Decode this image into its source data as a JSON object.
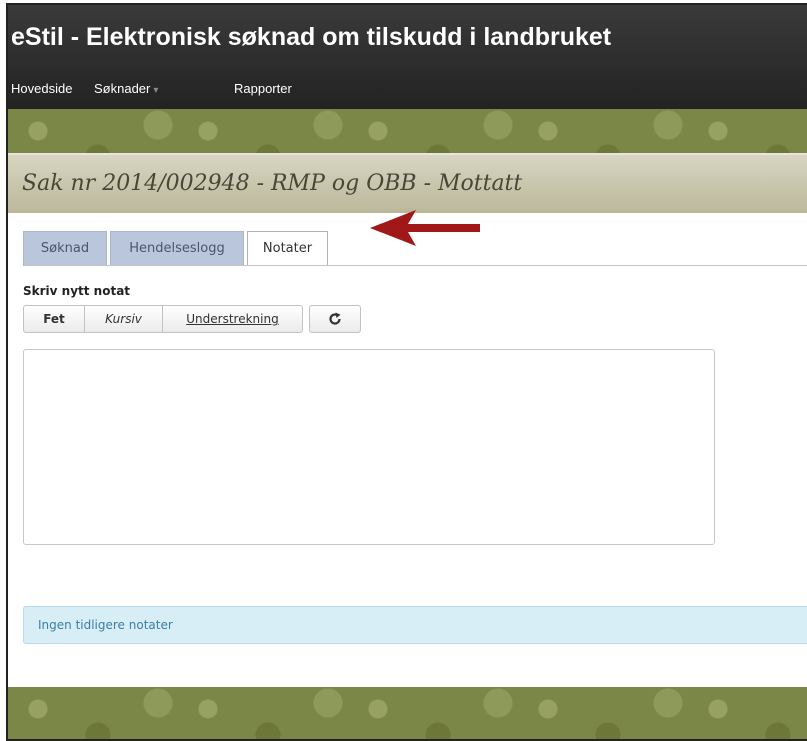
{
  "app": {
    "title": "eStil - Elektronisk søknad om tilskudd i landbruket"
  },
  "nav": {
    "items": [
      {
        "label": "Hovedside"
      },
      {
        "label": "Søknader"
      },
      {
        "label": "Rapporter"
      }
    ]
  },
  "case": {
    "title": "Sak nr 2014/002948 - RMP og OBB - Mottatt"
  },
  "tabs": [
    {
      "label": "Søknad",
      "active": false
    },
    {
      "label": "Hendelseslogg",
      "active": false
    },
    {
      "label": "Notater",
      "active": true
    }
  ],
  "note": {
    "section_label": "Skriv nytt notat",
    "toolbar": {
      "bold_label": "Fet",
      "italic_label": "Kursiv",
      "underline_label": "Understrekning",
      "refresh_icon": "refresh-icon"
    },
    "editor_value": ""
  },
  "info": {
    "message": "Ingen tidligere notater"
  },
  "colors": {
    "title_bar": "#2c2c2c",
    "inactive_tab": "#b9c6dc",
    "info_bg": "#d8eef6",
    "info_text": "#3a7fa8",
    "arrow": "#a01818"
  }
}
